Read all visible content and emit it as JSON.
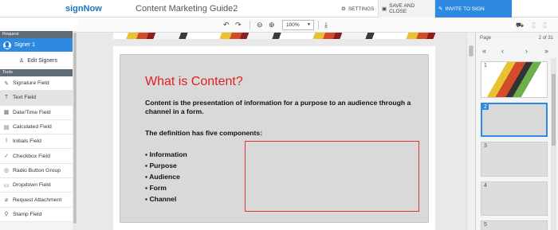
{
  "app": {
    "logo": "signNow",
    "document_title": "Content Marketing Guide2"
  },
  "header": {
    "settings_label": "SETTINGS",
    "save_close_label": "SAVE AND CLOSE",
    "invite_label": "INVITE TO SIGN"
  },
  "toolbar": {
    "zoom": "100%"
  },
  "left": {
    "request_heading": "Request",
    "signer_name": "Signer 1",
    "edit_signers_label": "Edit Signers",
    "tools_heading": "Tools",
    "tools": [
      {
        "label": "Signature Field",
        "icon": "pen-icon"
      },
      {
        "label": "Text Field",
        "icon": "text-icon"
      },
      {
        "label": "Date/Time Field",
        "icon": "calendar-icon"
      },
      {
        "label": "Calculated Field",
        "icon": "calculator-icon"
      },
      {
        "label": "Initials Field",
        "icon": "initials-icon"
      },
      {
        "label": "Checkbox Field",
        "icon": "checkbox-icon"
      },
      {
        "label": "Radio Button Group",
        "icon": "radio-icon"
      },
      {
        "label": "Dropdown Field",
        "icon": "dropdown-icon"
      },
      {
        "label": "Request Attachment",
        "icon": "paperclip-icon"
      },
      {
        "label": "Stamp Field",
        "icon": "stamp-icon"
      }
    ],
    "active_tool": 1
  },
  "slide": {
    "title": "What is Content?",
    "body": "Content is the presentation of information for a purpose to an audience through a channel in a form.",
    "definition": "The definition has five components:",
    "components": [
      "Information",
      "Purpose",
      "Audience",
      "Form",
      "Channel"
    ]
  },
  "pages": {
    "label": "Page",
    "current": "2 of 31",
    "thumbnails": [
      "1",
      "2",
      "3",
      "4",
      "5"
    ],
    "selected": 2
  }
}
